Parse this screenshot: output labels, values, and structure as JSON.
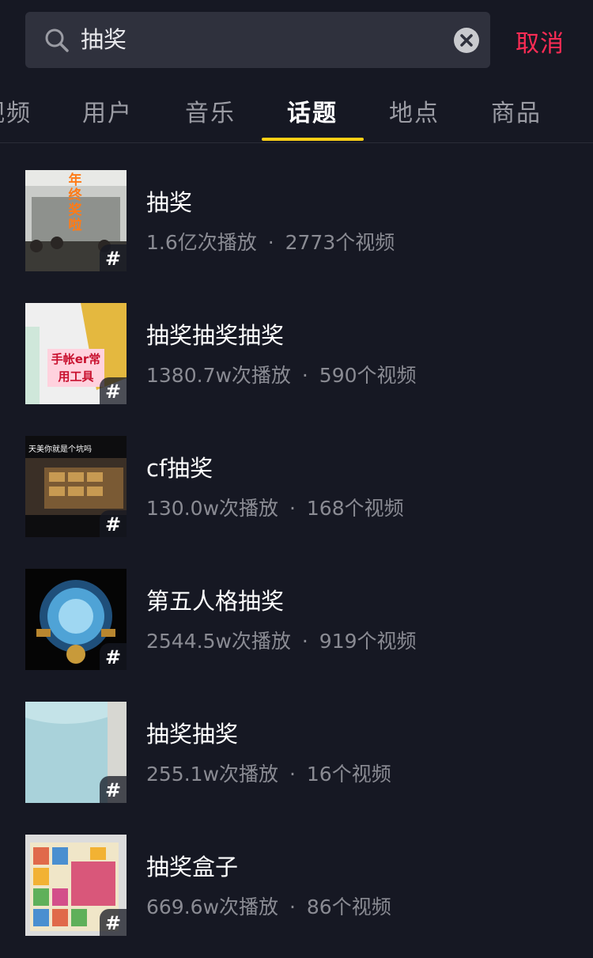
{
  "search": {
    "value": "抽奖",
    "cancel_label": "取消"
  },
  "tabs": [
    {
      "label": "视频"
    },
    {
      "label": "用户"
    },
    {
      "label": "音乐"
    },
    {
      "label": "话题",
      "active": true
    },
    {
      "label": "地点"
    },
    {
      "label": "商品"
    }
  ],
  "topics": [
    {
      "title": "抽奖",
      "plays": "1.6亿次播放",
      "videos": "2773个视频",
      "thumb_text": "年终奖啦"
    },
    {
      "title": "抽奖抽奖抽奖",
      "plays": "1380.7w次播放",
      "videos": "590个视频",
      "thumb_text": "手帐er常用工具"
    },
    {
      "title": "cf抽奖",
      "plays": "130.0w次播放",
      "videos": "168个视频",
      "thumb_text": "天美你就是个坑吗"
    },
    {
      "title": "第五人格抽奖",
      "plays": "2544.5w次播放",
      "videos": "919个视频"
    },
    {
      "title": "抽奖抽奖",
      "plays": "255.1w次播放",
      "videos": "16个视频"
    },
    {
      "title": "抽奖盒子",
      "plays": "669.6w次播放",
      "videos": "86个视频"
    }
  ],
  "separator": "·",
  "hash_symbol": "#",
  "colors": {
    "background": "#161823",
    "accent": "#fe2c55",
    "tab_indicator": "#face15"
  }
}
